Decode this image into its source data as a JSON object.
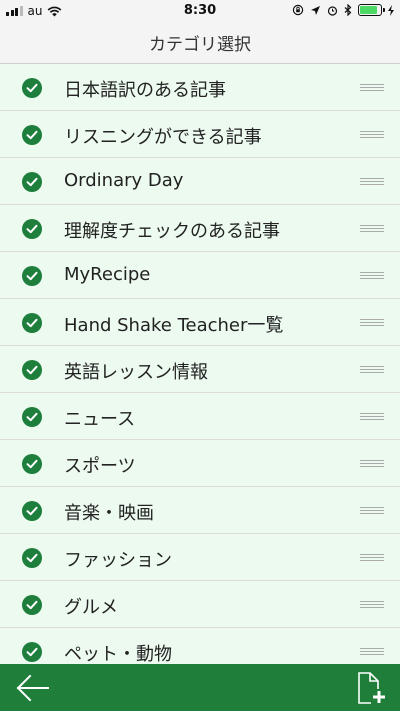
{
  "status_bar": {
    "carrier": "au",
    "time": "8:30",
    "battery_level": 0.85,
    "signal_bars": [
      1,
      1,
      1,
      0
    ]
  },
  "nav": {
    "title": "カテゴリ選択"
  },
  "categories": [
    {
      "label": "日本語訳のある記事",
      "checked": true
    },
    {
      "label": "リスニングができる記事",
      "checked": true
    },
    {
      "label": "Ordinary Day",
      "checked": true
    },
    {
      "label": "理解度チェックのある記事",
      "checked": true
    },
    {
      "label": "MyRecipe",
      "checked": true
    },
    {
      "label": "Hand Shake Teacher一覧",
      "checked": true
    },
    {
      "label": "英語レッスン情報",
      "checked": true
    },
    {
      "label": "ニュース",
      "checked": true
    },
    {
      "label": "スポーツ",
      "checked": true
    },
    {
      "label": "音楽・映画",
      "checked": true
    },
    {
      "label": "ファッション",
      "checked": true
    },
    {
      "label": "グルメ",
      "checked": true
    },
    {
      "label": "ペット・動物",
      "checked": true
    }
  ],
  "colors": {
    "accent": "#1f7f3a",
    "row_background": "#ecfaf0",
    "check": "#1e7e3c"
  },
  "icons": {
    "back": "arrow-left-icon",
    "add": "add-document-icon",
    "check": "check-circle-icon",
    "reorder": "drag-handle-icon"
  }
}
